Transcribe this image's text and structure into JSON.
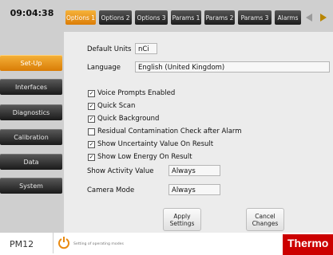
{
  "clock": "09:04:38",
  "sidebar": {
    "items": [
      {
        "label": "Set-Up",
        "active": true
      },
      {
        "label": "Interfaces",
        "active": false
      },
      {
        "label": "Diagnostics",
        "active": false
      },
      {
        "label": "Calibration",
        "active": false
      },
      {
        "label": "Data",
        "active": false
      },
      {
        "label": "System",
        "active": false
      }
    ]
  },
  "tabs": [
    {
      "label": "Options 1",
      "active": true
    },
    {
      "label": "Options 2",
      "active": false
    },
    {
      "label": "Options 3",
      "active": false
    },
    {
      "label": "Params 1",
      "active": false
    },
    {
      "label": "Params 2",
      "active": false
    },
    {
      "label": "Params 3",
      "active": false
    },
    {
      "label": "Alarms",
      "active": false
    }
  ],
  "tab_arrows": {
    "left": "triangle-left-icon",
    "right": "triangle-right-icon"
  },
  "settings": {
    "default_units_label": "Default Units",
    "default_units_value": "nCi",
    "language_label": "Language",
    "language_value": "English (United Kingdom)",
    "options": [
      {
        "label": "Voice Prompts Enabled",
        "checked": true
      },
      {
        "label": "Quick Scan",
        "checked": true
      },
      {
        "label": "Quick Background",
        "checked": true
      },
      {
        "label": "Residual Contamination Check after Alarm",
        "checked": false
      },
      {
        "label": "Show Uncertainty Value On Result",
        "checked": true
      },
      {
        "label": "Show Low Energy On Result",
        "checked": true
      }
    ],
    "show_activity_label": "Show Activity Value",
    "show_activity_value": "Always",
    "camera_mode_label": "Camera Mode",
    "camera_mode_value": "Always"
  },
  "actions": {
    "apply_line1": "Apply",
    "apply_line2": "Settings",
    "cancel_line1": "Cancel",
    "cancel_line2": "Changes"
  },
  "status": {
    "model": "PM12",
    "power_icon": "power-icon",
    "message": "Setting of operating modes",
    "logo": "Thermo"
  },
  "colors": {
    "accent_orange": "#e98a10",
    "dark_button": "#2a2a2a",
    "panel": "#ececec",
    "sidebar": "#cfcfcf",
    "brand_red": "#cc0000"
  }
}
